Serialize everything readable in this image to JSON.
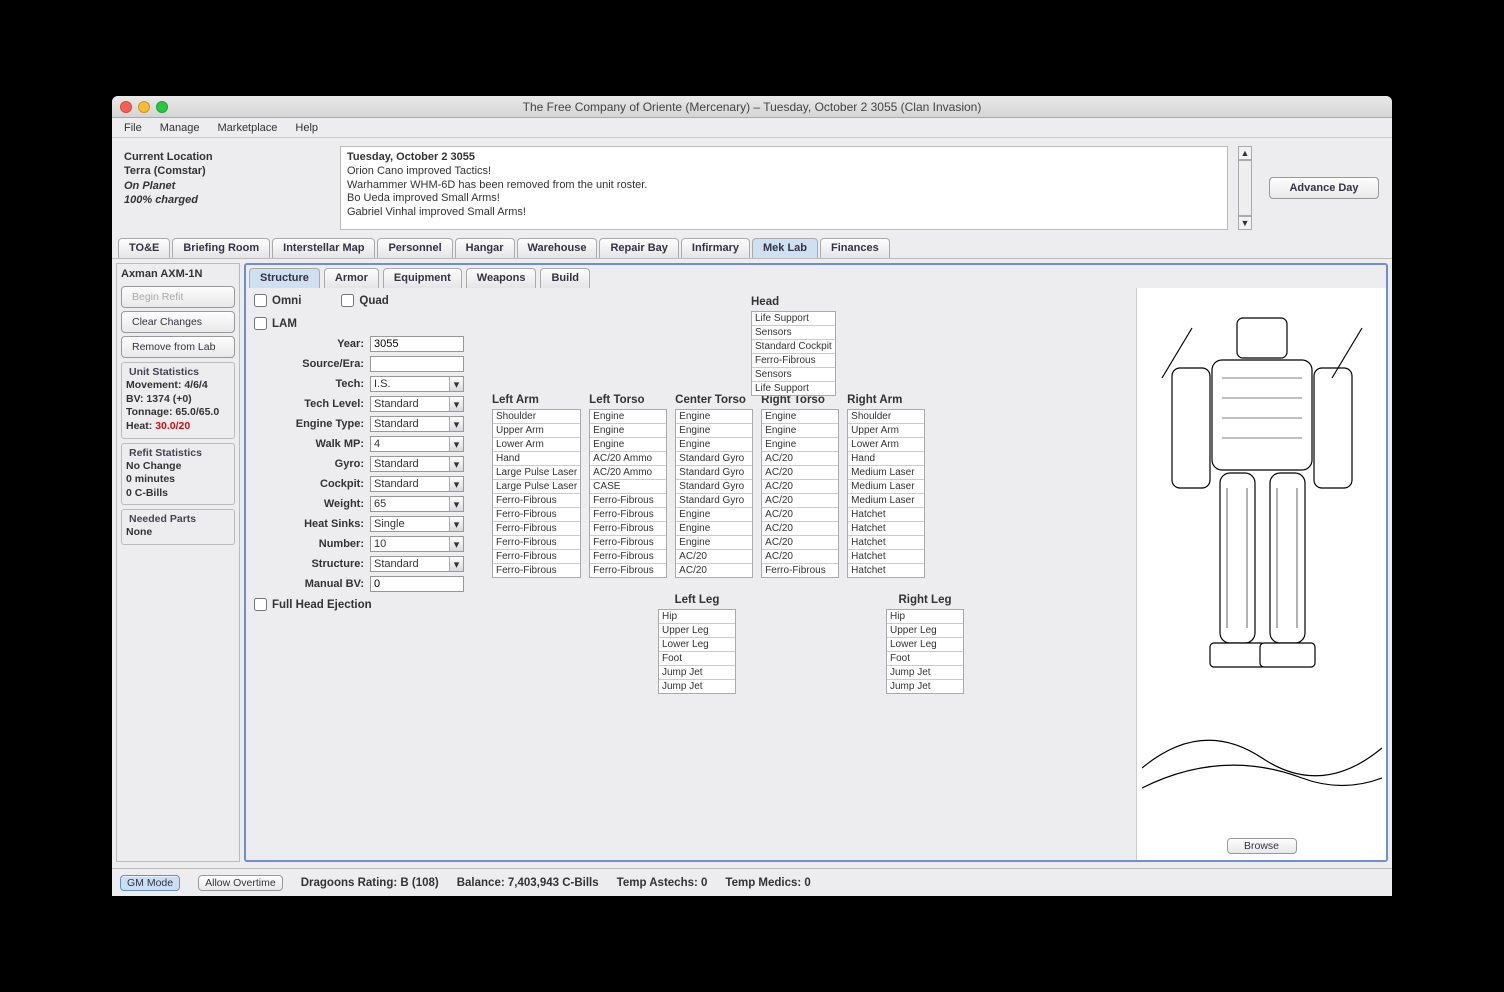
{
  "title": "The Free Company of Oriente (Mercenary) – Tuesday, October 2 3055 (Clan Invasion)",
  "menubar": [
    "File",
    "Manage",
    "Marketplace",
    "Help"
  ],
  "location": {
    "label": "Current Location",
    "where": "Terra (Comstar)",
    "status": "On Planet",
    "charge": "100% charged"
  },
  "log": {
    "date": "Tuesday, October 2 3055",
    "lines": [
      "Orion Cano improved Tactics!",
      "Warhammer WHM-6D has been removed from the unit roster.",
      "Bo Ueda improved Small Arms!",
      "Gabriel Vinhal improved Small Arms!"
    ]
  },
  "advance_label": "Advance Day",
  "maintabs": [
    "TO&E",
    "Briefing Room",
    "Interstellar Map",
    "Personnel",
    "Hangar",
    "Warehouse",
    "Repair Bay",
    "Infirmary",
    "Mek Lab",
    "Finances"
  ],
  "maintab_active": "Mek Lab",
  "unit": {
    "name": "Axman AXM-1N",
    "begin_refit": "Begin Refit",
    "clear_changes": "Clear Changes",
    "remove_lab": "Remove from Lab"
  },
  "stats": {
    "title": "Unit Statistics",
    "movement": "Movement: 4/6/4",
    "bv": "BV: 1374 (+0)",
    "tonnage": "Tonnage: 65.0/65.0",
    "heat_label": "Heat: ",
    "heat_val": "30.0/20"
  },
  "refit": {
    "title": "Refit Statistics",
    "l1": "No Change",
    "l2": "0 minutes",
    "l3": "0 C-Bills"
  },
  "parts": {
    "title": "Needed Parts",
    "l1": "None"
  },
  "subtabs": [
    "Structure",
    "Armor",
    "Equipment",
    "Weapons",
    "Build"
  ],
  "subtab_active": "Structure",
  "checks": {
    "omni": "Omni",
    "quad": "Quad",
    "lam": "LAM",
    "fullhead": "Full Head Ejection"
  },
  "cfg": {
    "year_l": "Year:",
    "year": "3055",
    "source_l": "Source/Era:",
    "source": "",
    "tech_l": "Tech:",
    "tech": "I.S.",
    "techlevel_l": "Tech Level:",
    "techlevel": "Standard",
    "engine_l": "Engine Type:",
    "engine": "Standard",
    "walk_l": "Walk MP:",
    "walk": "4",
    "gyro_l": "Gyro:",
    "gyro": "Standard",
    "cockpit_l": "Cockpit:",
    "cockpit": "Standard",
    "weight_l": "Weight:",
    "weight": "65",
    "hs_l": "Heat Sinks:",
    "hs": "Single",
    "num_l": "Number:",
    "num": "10",
    "struct_l": "Structure:",
    "struct": "Standard",
    "manualbv_l": "Manual BV:",
    "manualbv": "0"
  },
  "crit": {
    "head": {
      "title": "Head",
      "slots": [
        "Life Support",
        "Sensors",
        "Standard Cockpit",
        "Ferro-Fibrous",
        "Sensors",
        "Life Support"
      ]
    },
    "la": {
      "title": "Left Arm",
      "slots": [
        "Shoulder",
        "Upper Arm",
        "Lower Arm",
        "Hand",
        "Large Pulse Laser",
        "Large Pulse Laser",
        "Ferro-Fibrous",
        "Ferro-Fibrous",
        "Ferro-Fibrous",
        "Ferro-Fibrous",
        "Ferro-Fibrous",
        "Ferro-Fibrous"
      ]
    },
    "lt": {
      "title": "Left Torso",
      "slots": [
        "Engine",
        "Engine",
        "Engine",
        "AC/20 Ammo",
        "AC/20 Ammo",
        "CASE",
        "Ferro-Fibrous",
        "Ferro-Fibrous",
        "Ferro-Fibrous",
        "Ferro-Fibrous",
        "Ferro-Fibrous",
        "Ferro-Fibrous"
      ]
    },
    "ct": {
      "title": "Center Torso",
      "slots": [
        "Engine",
        "Engine",
        "Engine",
        "Standard Gyro",
        "Standard Gyro",
        "Standard Gyro",
        "Standard Gyro",
        "Engine",
        "Engine",
        "Engine",
        "AC/20",
        "AC/20"
      ]
    },
    "rt": {
      "title": "Right Torso",
      "slots": [
        "Engine",
        "Engine",
        "Engine",
        "AC/20",
        "AC/20",
        "AC/20",
        "AC/20",
        "AC/20",
        "AC/20",
        "AC/20",
        "AC/20",
        "Ferro-Fibrous"
      ]
    },
    "ra": {
      "title": "Right Arm",
      "slots": [
        "Shoulder",
        "Upper Arm",
        "Lower Arm",
        "Hand",
        "Medium Laser",
        "Medium Laser",
        "Medium Laser",
        "Hatchet",
        "Hatchet",
        "Hatchet",
        "Hatchet",
        "Hatchet"
      ]
    },
    "ll": {
      "title": "Left Leg",
      "slots": [
        "Hip",
        "Upper Leg",
        "Lower Leg",
        "Foot",
        "Jump Jet",
        "Jump Jet"
      ]
    },
    "rl": {
      "title": "Right Leg",
      "slots": [
        "Hip",
        "Upper Leg",
        "Lower Leg",
        "Foot",
        "Jump Jet",
        "Jump Jet"
      ]
    }
  },
  "browse": "Browse",
  "status": {
    "gm": "GM Mode",
    "overtime": "Allow Overtime",
    "rating": "Dragoons Rating: B (108)",
    "balance": "Balance: 7,403,943 C-Bills",
    "astechs": "Temp Astechs: 0",
    "medics": "Temp Medics: 0"
  }
}
